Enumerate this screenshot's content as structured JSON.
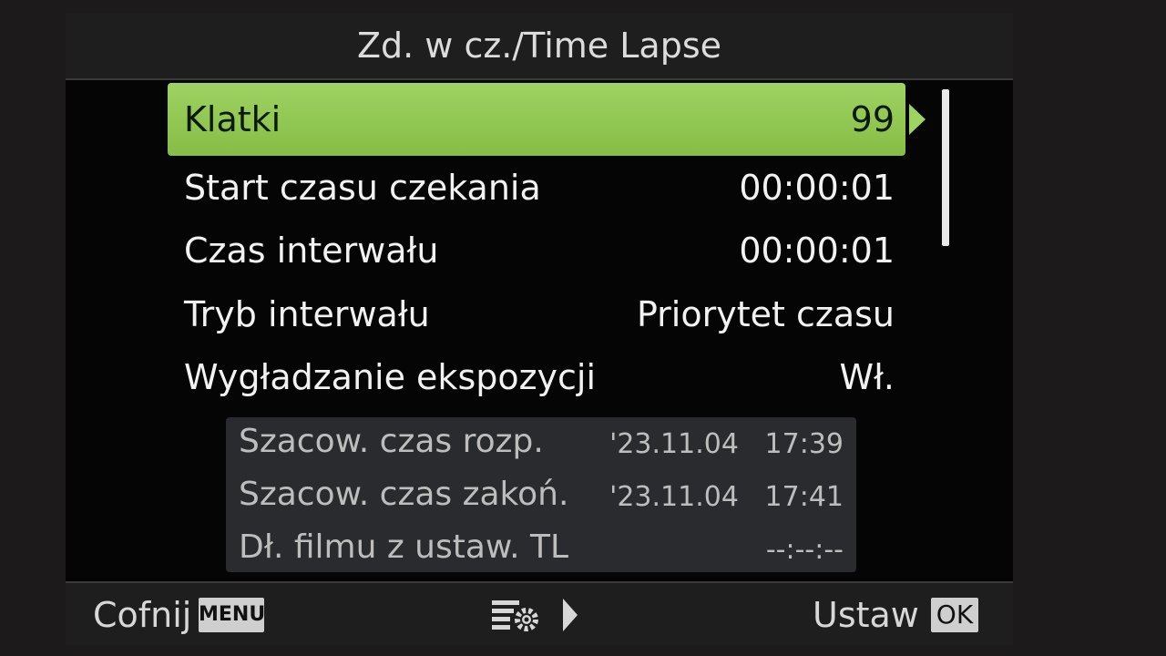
{
  "header": {
    "title": "Zd. w cz./Time Lapse",
    "battery_icon": "battery-icon"
  },
  "menu": {
    "items": [
      {
        "label": "Klatki",
        "value": "99",
        "selected": true
      },
      {
        "label": "Start czasu czekania",
        "value": "00:00:01",
        "selected": false
      },
      {
        "label": "Czas interwału",
        "value": "00:00:01",
        "selected": false
      },
      {
        "label": "Tryb interwału",
        "value": "Priorytet czasu",
        "selected": false
      },
      {
        "label": "Wygładzanie ekspozycji",
        "value": "Wł.",
        "selected": false
      }
    ],
    "highlight_color": "#8bc34a"
  },
  "info": {
    "rows": [
      {
        "label": "Szacow. czas rozp.",
        "value": "'23.11.04   17:39"
      },
      {
        "label": "Szacow. czas zakoń.",
        "value": "'23.11.04   17:41"
      },
      {
        "label": "Dł. filmu z ustaw. TL",
        "value": "--:--:--"
      }
    ]
  },
  "footer": {
    "back_label": "Cofnij",
    "back_key": "MENU",
    "settings_icon": "menu-settings-icon",
    "set_label": "Ustaw",
    "set_key": "OK"
  }
}
